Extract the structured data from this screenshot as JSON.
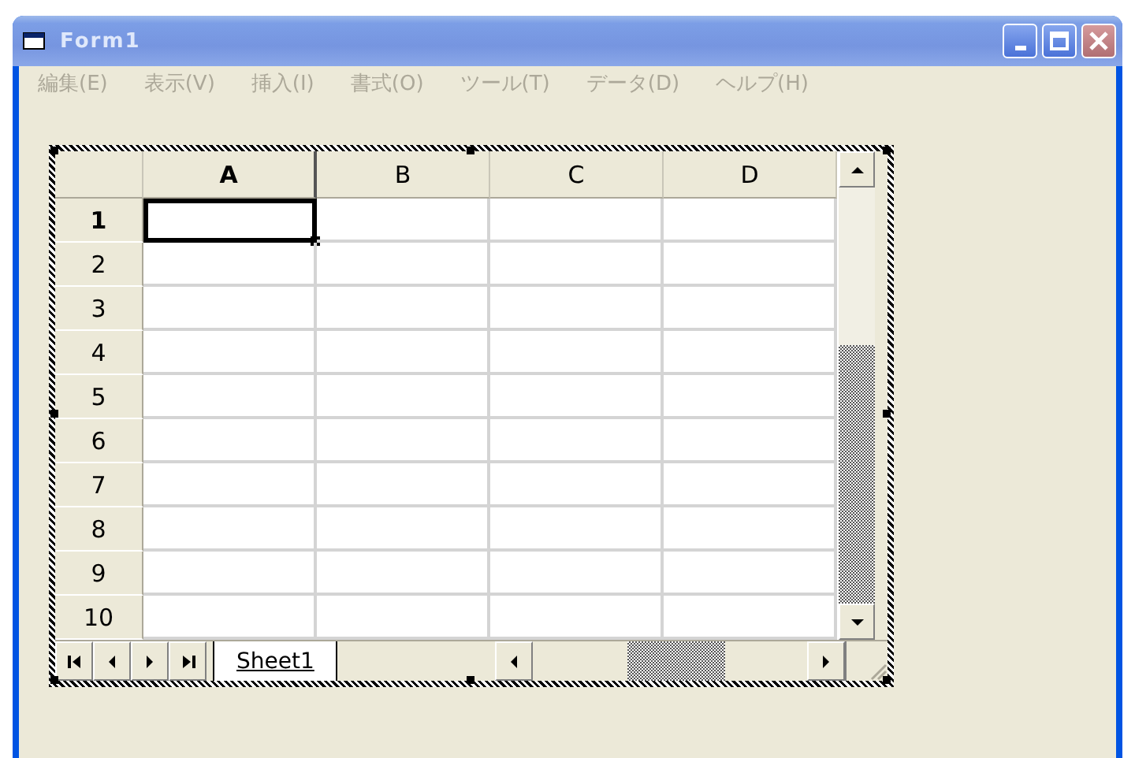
{
  "window": {
    "title": "Form1",
    "buttons": [
      {
        "kind": "minimize"
      },
      {
        "kind": "maximize"
      },
      {
        "kind": "close"
      }
    ]
  },
  "menu": [
    {
      "label": "編集(E)",
      "disabled": true
    },
    {
      "label": "表示(V)",
      "disabled": true
    },
    {
      "label": "挿入(I)",
      "disabled": true
    },
    {
      "label": "書式(O)",
      "disabled": true
    },
    {
      "label": "ツール(T)",
      "disabled": true
    },
    {
      "label": "データ(D)",
      "disabled": true
    },
    {
      "label": "ヘルプ(H)",
      "disabled": true
    }
  ],
  "sheet": {
    "columns": [
      {
        "label": "A",
        "selected": true
      },
      {
        "label": "B",
        "selected": false
      },
      {
        "label": "C",
        "selected": false
      },
      {
        "label": "D",
        "selected": false
      }
    ],
    "rows": [
      {
        "label": "1",
        "selected": true
      },
      {
        "label": "2",
        "selected": false
      },
      {
        "label": "3",
        "selected": false
      },
      {
        "label": "4",
        "selected": false
      },
      {
        "label": "5",
        "selected": false
      },
      {
        "label": "6",
        "selected": false
      },
      {
        "label": "7",
        "selected": false
      },
      {
        "label": "8",
        "selected": false
      },
      {
        "label": "9",
        "selected": false
      },
      {
        "label": "10",
        "selected": false
      }
    ],
    "tabs": [
      {
        "label": "Sheet1",
        "selected": true
      }
    ]
  }
}
